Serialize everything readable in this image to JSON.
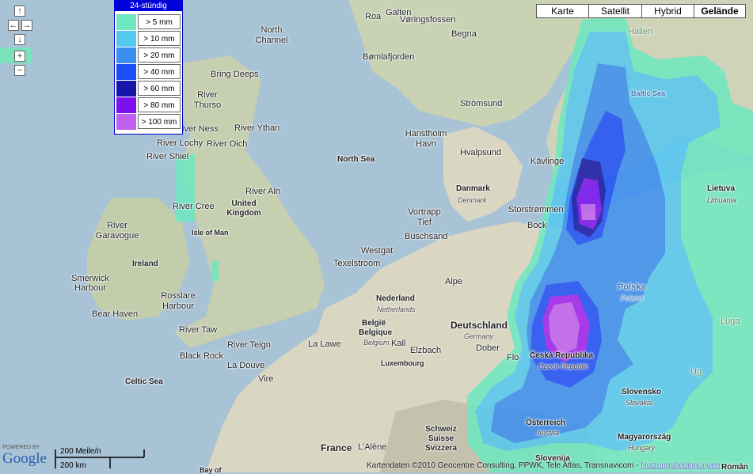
{
  "colors": {
    "sea": "#a9c3d6",
    "land": "#d9d6c2",
    "land_dark": "#b8c6a6",
    "r5": "#6ee8c0",
    "r10": "#55c8f0",
    "r20": "#3b8ef0",
    "r40": "#1c4ef8",
    "r60": "#1616a8",
    "r80": "#7c10f0",
    "r100": "#c060f0",
    "legend_header": "#0000dd"
  },
  "navigation": {
    "up_icon": "↑",
    "left_icon": "←",
    "right_icon": "→",
    "down_icon": "↓",
    "zoom_in_icon": "+",
    "zoom_out_icon": "−"
  },
  "legend": {
    "title": "24-stündig",
    "items": [
      {
        "label": "> 5 mm",
        "color": "#6ee8c0"
      },
      {
        "label": "> 10 mm",
        "color": "#55c8f0"
      },
      {
        "label": "> 20 mm",
        "color": "#3b8ef0"
      },
      {
        "label": "> 40 mm",
        "color": "#1c4ef8"
      },
      {
        "label": "> 60 mm",
        "color": "#1616a8"
      },
      {
        "label": "> 80 mm",
        "color": "#7c10f0"
      },
      {
        "label": "> 100 mm",
        "color": "#c060f0"
      }
    ]
  },
  "map_types": {
    "karte": "Karte",
    "satellit": "Satellit",
    "hybrid": "Hybrid",
    "gelaende": "Gelände",
    "active": "Gelände"
  },
  "labels": {
    "roa": "Roa",
    "galten": "Galten",
    "voringsfossen": "Vøringsfossen",
    "begna": "Begna",
    "north_channel": "North Channel",
    "bomlafjorden": "Bømlafjorden",
    "bring_deeps": "Bring Deeps",
    "river_thurso": "River Thurso",
    "river_ness": "River Ness",
    "river_ythan": "River Ythan",
    "river_lochy": "River Lochy",
    "river_oich": "River Oich",
    "river_shiel": "River Shiel",
    "stromsund": "Strömsund",
    "hanstholm": "Hanstholm Havn",
    "hvalpsund": "Hvalpsund",
    "north_sea": "North Sea",
    "kavlinge": "Kävlinge",
    "river_aln": "River Aln",
    "united_kingdom": "United Kingdom",
    "river_cree": "River Cree",
    "river_garavogue": "River Garavogue",
    "isle_of_man": "Isle of Man",
    "danmark": "Danmark",
    "danmark_local": "Denmark",
    "vortrapp": "Vortrapp Tief",
    "storstrommen": "Storstrømmen",
    "buschsand": "Buschsand",
    "bock": "Bock",
    "ireland": "Ireland",
    "westgat": "Westgat",
    "texelstroom": "Texelstroom",
    "smerwick": "Smerwick Harbour",
    "rosslare": "Rosslare Harbour",
    "alpe": "Alpe",
    "nederland": "Nederland",
    "netherlands": "Netherlands",
    "bear_haven": "Bear Haven",
    "belgie": "België",
    "belgique": "Belgique",
    "belgium": "Belgium",
    "deutschland": "Deutschland",
    "germany": "Germany",
    "river_taw": "River Taw",
    "river_teign": "River Teign",
    "la_lawe": "La Lawe",
    "kall": "Kall",
    "elzbach": "Elzbach",
    "dober": "Dober",
    "black_rock": "Black Rock",
    "la_douve": "La Douve",
    "luxembourg": "Luxembourg",
    "celtic_sea": "Celtic Sea",
    "vire": "Vire",
    "flo": "Flo",
    "ceska": "Česká Republika",
    "czech": "Czech Republic",
    "polska": "Polska",
    "poland": "Poland",
    "lietuva": "Lietuva",
    "lithuania": "Lithuania",
    "baltic_sea": "Baltic Sea",
    "hallen": "Hallen",
    "luga": "Luga",
    "slovensko": "Slovensko",
    "slovakia": "Slovakia",
    "osterreich": "Österreich",
    "austria": "Austria",
    "schweiz": "Schweiz Suisse Svizzera",
    "magyarorszag": "Magyarország",
    "hungary": "Hungary",
    "slovenija": "Slovenija",
    "france": "France",
    "l_alene": "L'Alène",
    "roman": "Român",
    "ug": "Ug",
    "bay_of": "Bay of"
  },
  "scale": {
    "miles": "200 Meile/n",
    "km": "200 km"
  },
  "branding": {
    "powered_by": "POWERED BY",
    "google": "Google"
  },
  "attribution": {
    "text": "Kartendaten ©2010 Geocentre Consulting, PPWK, Tele Atlas, Transnavicom -",
    "terms": "Nutzungsbedingungen"
  }
}
